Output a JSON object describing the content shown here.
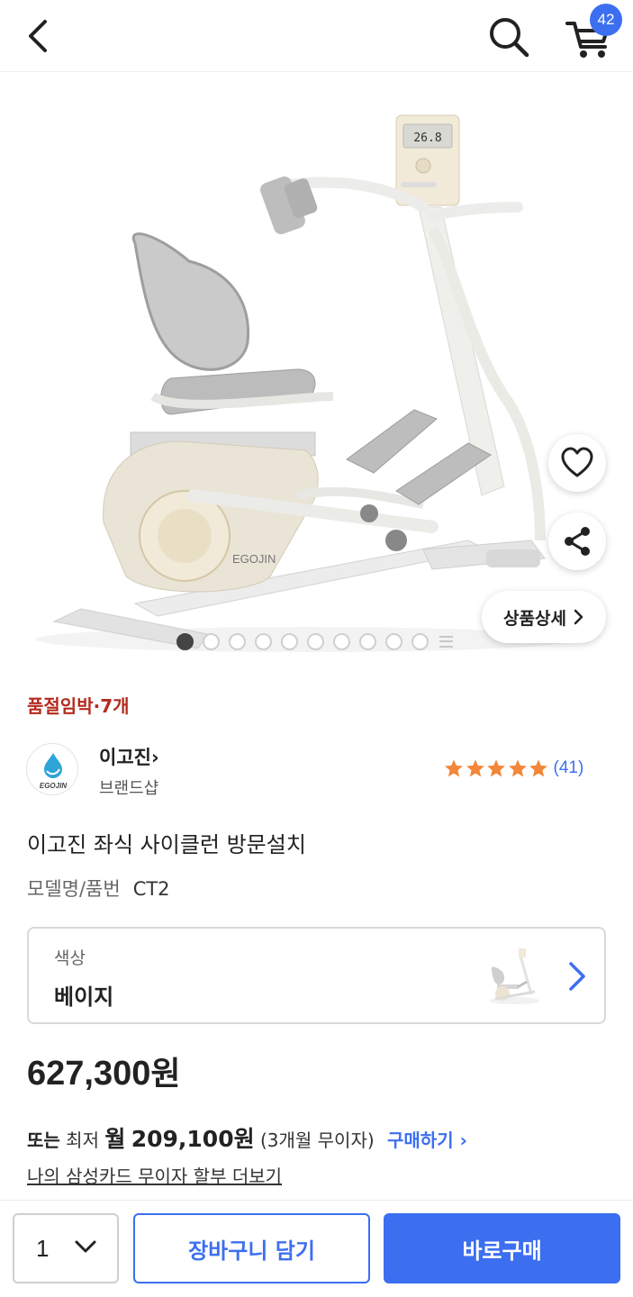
{
  "header": {
    "back_icon": "chevron-left-icon",
    "search_icon": "search-icon",
    "cart_icon": "cart-icon",
    "cart_count": "42"
  },
  "gallery": {
    "brand_mark": "EGOJIN",
    "display_readout": "26.8",
    "detail_label": "상품상세",
    "slide_count": 10,
    "active_slide": 1,
    "favorite_icon": "heart-icon",
    "share_icon": "share-icon"
  },
  "stock_notice": "품절임박·7개",
  "brand": {
    "name": "이고진",
    "arrow": "›",
    "shop_label": "브랜드샵",
    "logo_text": "EGOJIN"
  },
  "rating": {
    "stars": 5,
    "count": "(41)"
  },
  "product": {
    "title": "이고진 좌식 사이클런 방문설치",
    "model_label": "모델명/품번",
    "model_value": "CT2"
  },
  "option": {
    "label": "색상",
    "value": "베이지"
  },
  "price": {
    "amount": "627,300",
    "unit": "원"
  },
  "installment": {
    "prefix": "또는",
    "lowest": "최저",
    "monthly_label": "월",
    "amount": "209,100원",
    "terms": "(3개월 무이자)",
    "buy_link": "구매하기 ›",
    "card_link": "나의 삼성카드 무이자 할부 더보기"
  },
  "bottom_bar": {
    "quantity": "1",
    "add_to_cart": "장바구니 담기",
    "buy_now": "바로구매"
  },
  "colors": {
    "accent": "#3c6ff0",
    "stock_red": "#b52a1e",
    "star_orange": "#f2873a"
  }
}
